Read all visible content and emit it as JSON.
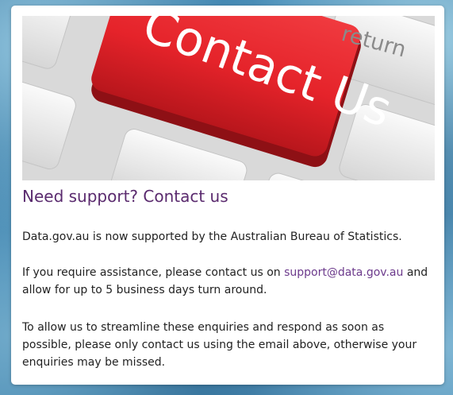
{
  "card": {
    "hero_image": {
      "key_text": "Contact Us",
      "return_key_text": "return",
      "key_color": "#e5232a"
    },
    "title": "Need support? Contact us",
    "paragraph_1": "Data.gov.au is now supported by the Australian Bureau of Statistics.",
    "paragraph_2_before": "If you require assistance, please contact us on ",
    "email": "support@data.gov.au",
    "paragraph_2_after": " and allow for up to 5 business days turn around.",
    "paragraph_3": "To allow us to streamline these enquiries and respond as soon as possible, please only contact us using the email above, otherwise your enquiries may be missed."
  },
  "colors": {
    "title": "#5a2a6e",
    "link": "#6c3a8c",
    "text": "#222222"
  }
}
